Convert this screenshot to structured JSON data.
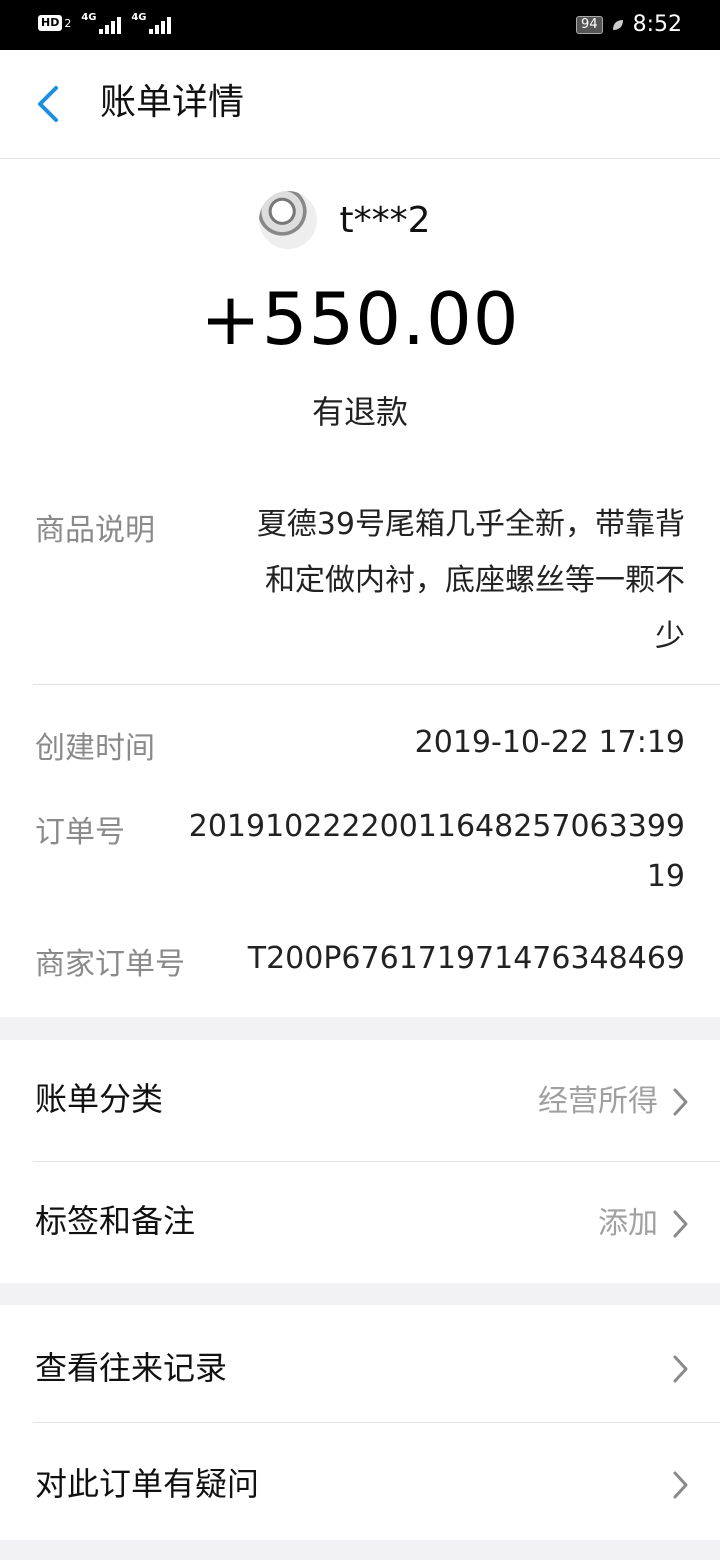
{
  "status_bar": {
    "hd_label": "HD",
    "hd_sub": "2",
    "signal1_label": "4G",
    "signal2_label": "4G",
    "battery": "94",
    "time": "8:52"
  },
  "nav": {
    "title": "账单详情"
  },
  "bill": {
    "payer_name": "t***2",
    "amount": "+550.00",
    "status": "有退款"
  },
  "details": {
    "description_label": "商品说明",
    "description_lines": [
      "夏德39号尾箱几乎全新，带靠背",
      "和定做内衬，底座螺丝等一颗不",
      "少"
    ],
    "created_label": "创建时间",
    "created_value": "2019-10-22 17:19",
    "order_no_label": "订单号",
    "order_no_lines": [
      "20191022220011648257063399",
      "19"
    ],
    "merchant_order_label": "商家订单号",
    "merchant_order_value": "T200P676171971476348469"
  },
  "section2": {
    "category_label": "账单分类",
    "category_value": "经营所得",
    "tags_label": "标签和备注",
    "tags_value": "添加"
  },
  "section3": {
    "history_label": "查看往来记录",
    "question_label": "对此订单有疑问"
  },
  "icons": {
    "back": "chevron-left-icon",
    "chevron": "chevron-right-icon",
    "avatar": "avatar"
  },
  "colors": {
    "accent": "#1a8fe0",
    "muted": "#8a8a8a",
    "background": "#f2f2f4"
  }
}
